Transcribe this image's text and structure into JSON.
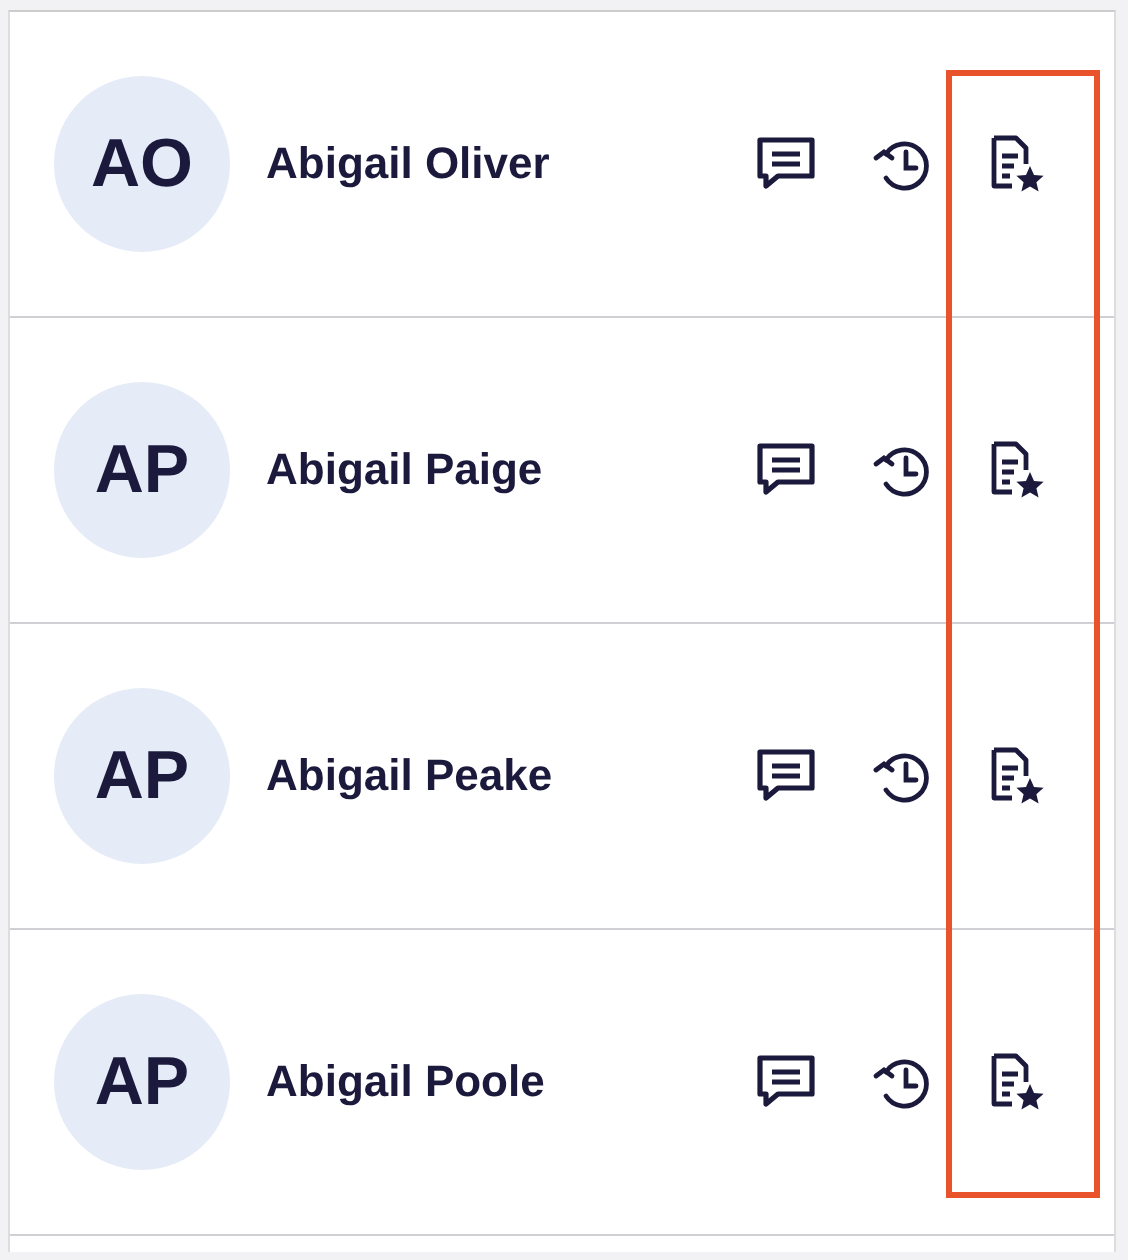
{
  "contacts": [
    {
      "initials": "AO",
      "name": "Abigail Oliver"
    },
    {
      "initials": "AP",
      "name": "Abigail Paige"
    },
    {
      "initials": "AP",
      "name": "Abigail Peake"
    },
    {
      "initials": "AP",
      "name": "Abigail Poole"
    }
  ]
}
